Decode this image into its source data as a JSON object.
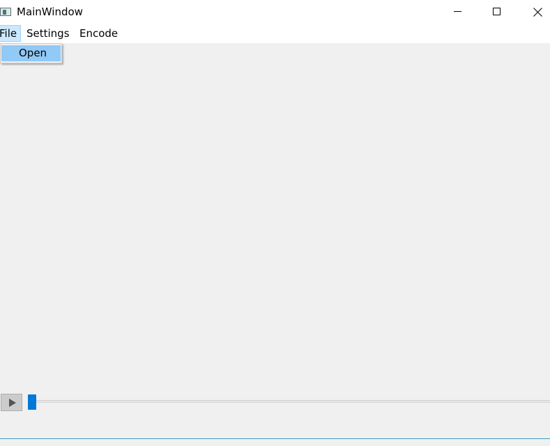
{
  "window": {
    "title": "MainWindow",
    "icon": "app-window-icon",
    "controls": [
      "minimize-icon",
      "maximize-icon",
      "close-icon"
    ]
  },
  "menubar": {
    "items": [
      {
        "label": "File"
      },
      {
        "label": "Settings"
      },
      {
        "label": "Encode"
      }
    ]
  },
  "file_menu": {
    "items": [
      {
        "label": "Open"
      }
    ]
  },
  "player": {
    "play_icon": "play-icon",
    "position": 0
  },
  "colors": {
    "accent": "#0078d7",
    "menu_highlight": "#91c9f7",
    "menu_active": "#cce8ff"
  }
}
